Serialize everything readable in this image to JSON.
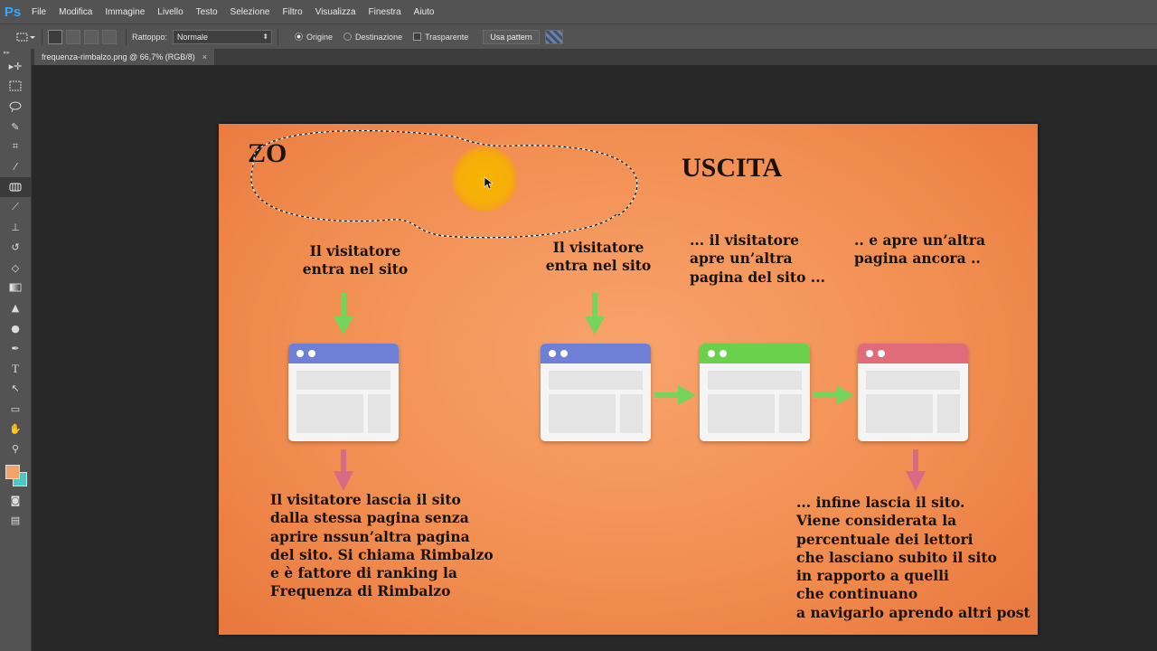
{
  "app": {
    "logo": "Ps"
  },
  "menu": [
    "File",
    "Modifica",
    "Immagine",
    "Livello",
    "Testo",
    "Selezione",
    "Filtro",
    "Visualizza",
    "Finestra",
    "Aiuto"
  ],
  "options": {
    "patch_label": "Rattoppo:",
    "patch_mode": "Normale",
    "source_label": "Origine",
    "destination_label": "Destinazione",
    "transparent_label": "Trasparente",
    "use_pattern_label": "Usa pattern"
  },
  "tools": [
    "move-tool",
    "marquee-tool",
    "lasso-tool",
    "quick-selection-tool",
    "crop-tool",
    "eyedropper-tool",
    "patch-tool",
    "brush-tool",
    "clone-stamp-tool",
    "history-brush-tool",
    "eraser-tool",
    "gradient-tool",
    "blur-tool",
    "dodge-tool",
    "pen-tool",
    "type-tool",
    "path-selection-tool",
    "shape-tool",
    "hand-tool",
    "zoom-tool"
  ],
  "colors": {
    "foreground": "#f4a46a",
    "background": "#4dc7c2",
    "accent": "#31a8ff"
  },
  "document": {
    "tab_title": "frequenza-rimbalzo.png @ 66,7% (RGB/8)",
    "close_glyph": "×"
  },
  "slide": {
    "heading_left": "ZO",
    "heading_right": "USCITA",
    "bounce_enter": [
      "Il visitatore",
      "entra nel sito"
    ],
    "bounce_leave": [
      "Il visitatore lascia il sito",
      "dalla stessa pagina senza",
      "aprire nssun’altra pagina",
      "del sito. Si chiama Rimbalzo",
      "e è fattore  di ranking la",
      "Frequenza di Rimbalzo"
    ],
    "exit_enter": [
      "Il visitatore",
      "entra nel sito"
    ],
    "exit_next": [
      "... il visitatore",
      "apre un’altra",
      "pagina del sito ..."
    ],
    "exit_another": [
      ".. e apre un’altra",
      "pagina ancora .."
    ],
    "exit_leave": [
      "... infine lascia il sito.",
      "Viene considerata la",
      "percentuale dei lettori",
      "che lasciano subito il sito",
      "in rapporto a quelli",
      "che continuano",
      "a navigarlo aprendo altri post"
    ],
    "browser_colors": {
      "blue": "#6e7fd6",
      "green": "#6bd04c",
      "red": "#e06c79"
    },
    "arrow_colors": {
      "green": "#74d45c",
      "pink": "#d96a86"
    }
  }
}
